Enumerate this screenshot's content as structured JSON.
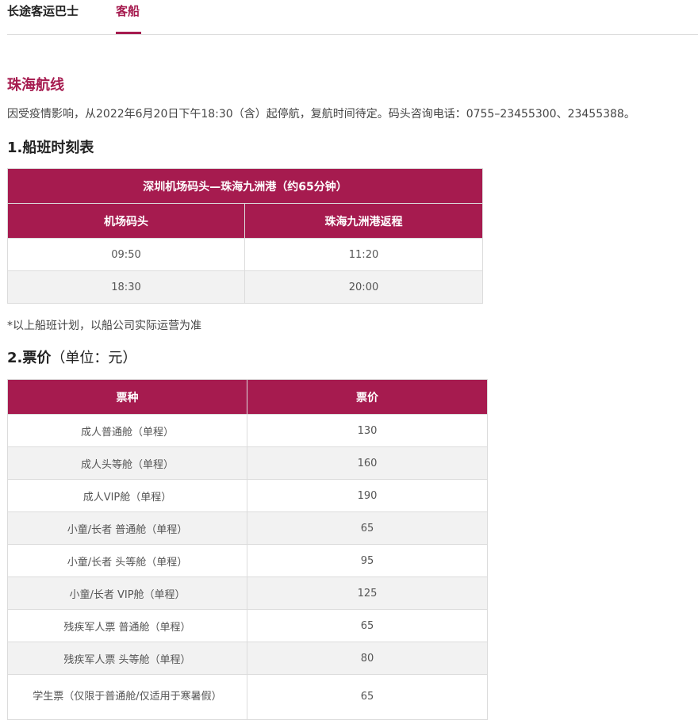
{
  "tabs": {
    "bus": "长途客运巴士",
    "boat": "客船",
    "active": "boat"
  },
  "accent_color": "#a61b4f",
  "route": {
    "title": "珠海航线",
    "notice": "因受疫情影响，从2022年6月20日下午18:30（含）起停航，复航时间待定。码头咨询电话：0755–23455300、23455388。"
  },
  "schedule": {
    "section_title": "1.船班时刻表",
    "route_header": "深圳机场码头—珠海九洲港（约65分钟）",
    "columns": [
      "机场码头",
      "珠海九洲港返程"
    ],
    "rows": [
      [
        "09:50",
        "11:20"
      ],
      [
        "18:30",
        "20:00"
      ]
    ],
    "footnote": "*以上船班计划，以船公司实际运营为准"
  },
  "prices": {
    "section_title": "2.票价",
    "unit": "（单位：元）",
    "columns": [
      "票种",
      "票价"
    ],
    "rows": [
      [
        "成人普通舱（单程）",
        "130"
      ],
      [
        "成人头等舱（单程）",
        "160"
      ],
      [
        "成人VIP舱（单程）",
        "190"
      ],
      [
        "小童/长者 普通舱（单程）",
        "65"
      ],
      [
        "小童/长者 头等舱（单程）",
        "95"
      ],
      [
        "小童/长者 VIP舱（单程）",
        "125"
      ],
      [
        "残疾军人票 普通舱（单程）",
        "65"
      ],
      [
        "残疾军人票 头等舱（单程）",
        "80"
      ],
      [
        "学生票（仅限于普通舱/仅适用于寒暑假）",
        "65"
      ]
    ]
  }
}
